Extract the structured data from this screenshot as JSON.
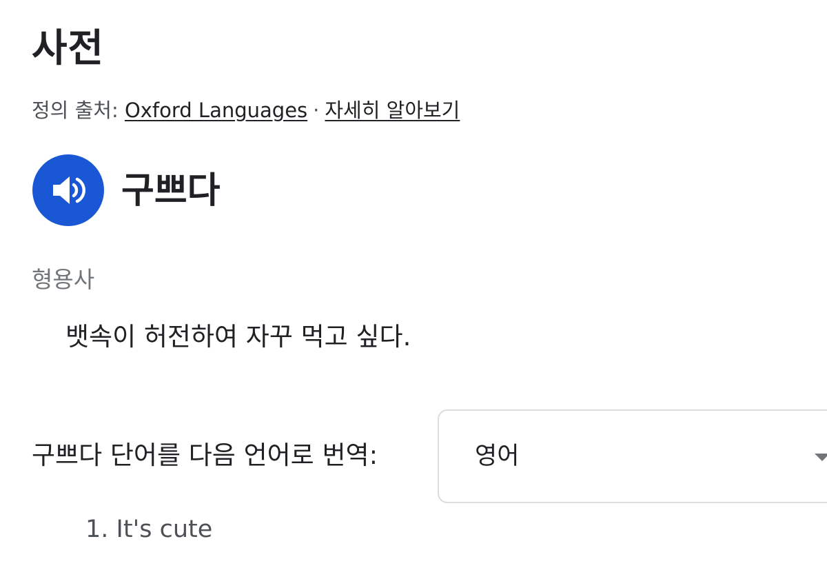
{
  "header": {
    "title": "사전"
  },
  "source": {
    "prefix": "정의 출처:",
    "provider_link": "Oxford Languages",
    "separator": "·",
    "learn_more_link": "자세히 알아보기"
  },
  "entry": {
    "speaker_icon": "volume-up-icon",
    "headword": "구쁘다",
    "part_of_speech": "형용사",
    "definition": "뱃속이 허전하여 자꾸 먹고 싶다."
  },
  "translate": {
    "label": "구쁘다 단어를 다음 언어로 번역:",
    "selected_language": "영어",
    "caret_icon": "caret-down-icon",
    "results": [
      {
        "index": "1.",
        "text": "It's cute"
      }
    ]
  },
  "colors": {
    "accent": "#1a57d4",
    "text": "#202124",
    "muted": "#70757a",
    "border": "#dadce0"
  }
}
